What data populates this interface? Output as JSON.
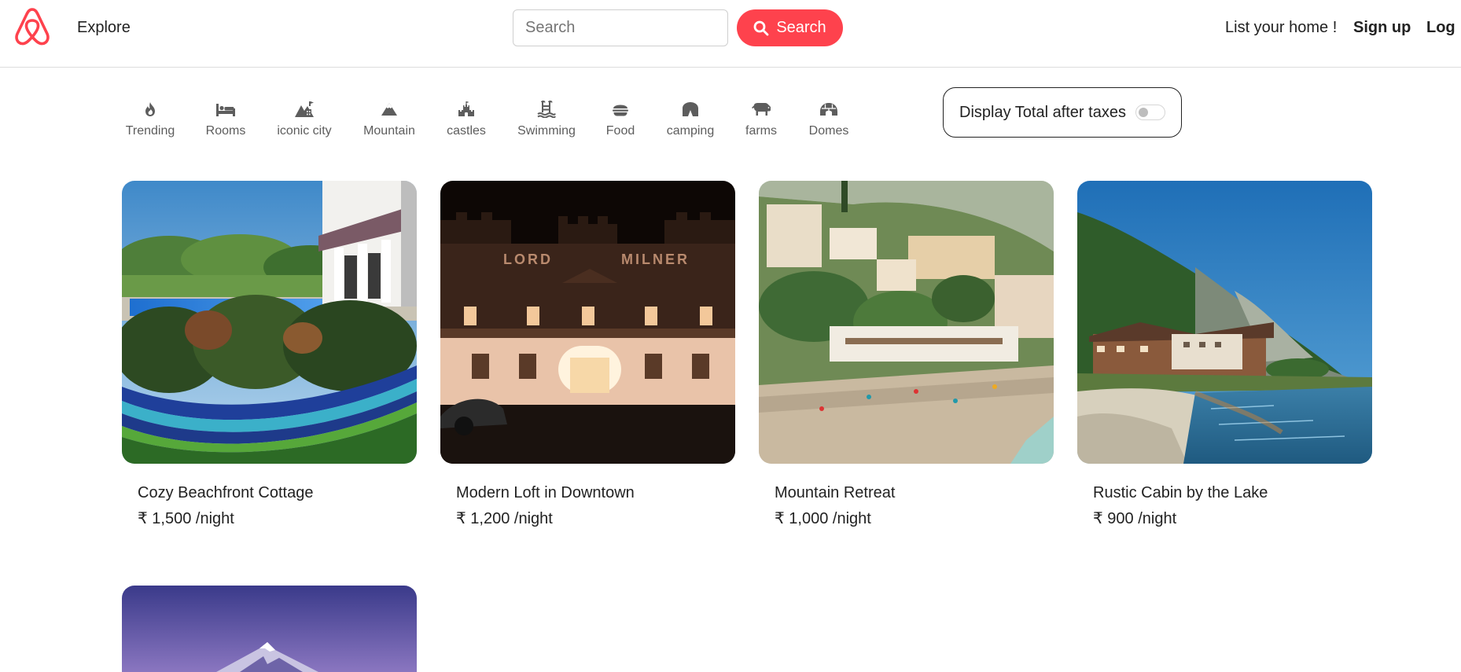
{
  "nav": {
    "explore": "Explore",
    "search_placeholder": "Search",
    "search_button": "Search",
    "list_home": "List your home !",
    "signup": "Sign up",
    "login": "Log"
  },
  "filters": [
    {
      "label": "Trending",
      "icon": "fire-icon"
    },
    {
      "label": "Rooms",
      "icon": "bed-icon"
    },
    {
      "label": "iconic city",
      "icon": "city-icon"
    },
    {
      "label": "Mountain",
      "icon": "mountain-icon"
    },
    {
      "label": "castles",
      "icon": "castle-icon"
    },
    {
      "label": "Swimming",
      "icon": "pool-icon"
    },
    {
      "label": "Food",
      "icon": "burger-icon"
    },
    {
      "label": "camping",
      "icon": "tent-icon"
    },
    {
      "label": "farms",
      "icon": "cow-icon"
    },
    {
      "label": "Domes",
      "icon": "igloo-icon"
    }
  ],
  "tax_toggle": {
    "label": "Display Total after taxes",
    "enabled": false
  },
  "listings": [
    {
      "title": "Cozy Beachfront Cottage",
      "price": "₹ 1,500 /night"
    },
    {
      "title": "Modern Loft in Downtown",
      "price": "₹ 1,200 /night"
    },
    {
      "title": "Mountain Retreat",
      "price": "₹ 1,000 /night"
    },
    {
      "title": "Rustic Cabin by the Lake",
      "price": "₹ 900 /night"
    }
  ],
  "colors": {
    "brand": "#fe424d",
    "text": "#222222",
    "muted": "#555555"
  }
}
